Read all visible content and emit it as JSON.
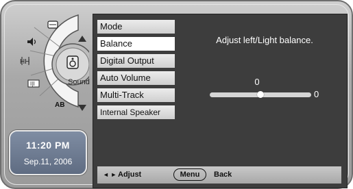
{
  "nav": {
    "center_label": "Sound",
    "ab_label": "AB",
    "icons": [
      "display-icon",
      "speaker-icon",
      "equalizer-icon",
      "sound-icon",
      "multi-track-icon"
    ]
  },
  "clock": {
    "time": "11:20 PM",
    "date": "Sep.11, 2006"
  },
  "menu": {
    "items": [
      {
        "label": "Mode"
      },
      {
        "label": "Balance"
      },
      {
        "label": "Digital Output"
      },
      {
        "label": "Auto Volume"
      },
      {
        "label": "Multi-Track"
      },
      {
        "label": "Internal Speaker"
      }
    ],
    "selected_index": 1
  },
  "balance": {
    "prompt": "Adjust left/Light balance.",
    "value": "0",
    "side_value": "0",
    "position": 0.5
  },
  "footer": {
    "arrows": "◄ ►",
    "adjust_label": "Adjust",
    "menu_label": "Menu",
    "back_label": "Back"
  },
  "colors": {
    "panel": "#3d3d3d",
    "clock": "#6b7890",
    "frame": "#a9a9a9"
  }
}
